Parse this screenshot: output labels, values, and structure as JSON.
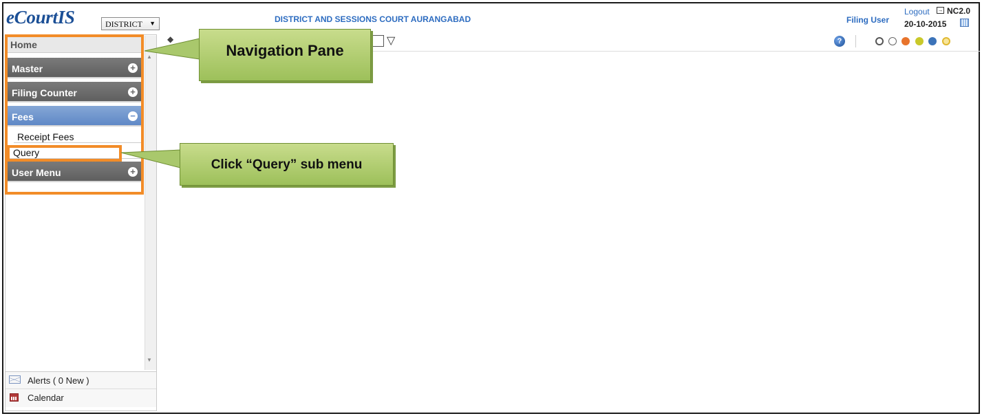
{
  "header": {
    "logo": "eCourtIS",
    "district_select": "DISTRICT",
    "court_name": "DISTRICT AND SESSIONS COURT AURANGABAD",
    "user": "Filing User",
    "logout": "Logout",
    "version": "NC2.0",
    "date": "20-10-2015"
  },
  "toolbar": {
    "help_icon": "?",
    "theme_colors": [
      "#ffffff",
      "#ffffff",
      "#e8742c",
      "#c9c92a",
      "#3b73b9",
      "#f2d66a"
    ]
  },
  "sidebar": {
    "home": "Home",
    "menus": [
      {
        "label": "Master",
        "state": "+"
      },
      {
        "label": "Filing Counter",
        "state": "+"
      },
      {
        "label": "Fees",
        "state": "−",
        "items": [
          "Receipt Fees",
          "Query"
        ]
      },
      {
        "label": "User Menu",
        "state": "+"
      }
    ],
    "alerts": "Alerts ( 0 New )",
    "calendar": "Calendar"
  },
  "annotations": {
    "navigation_pane": "Navigation Pane",
    "query_instruction": "Click “Query” sub menu"
  }
}
